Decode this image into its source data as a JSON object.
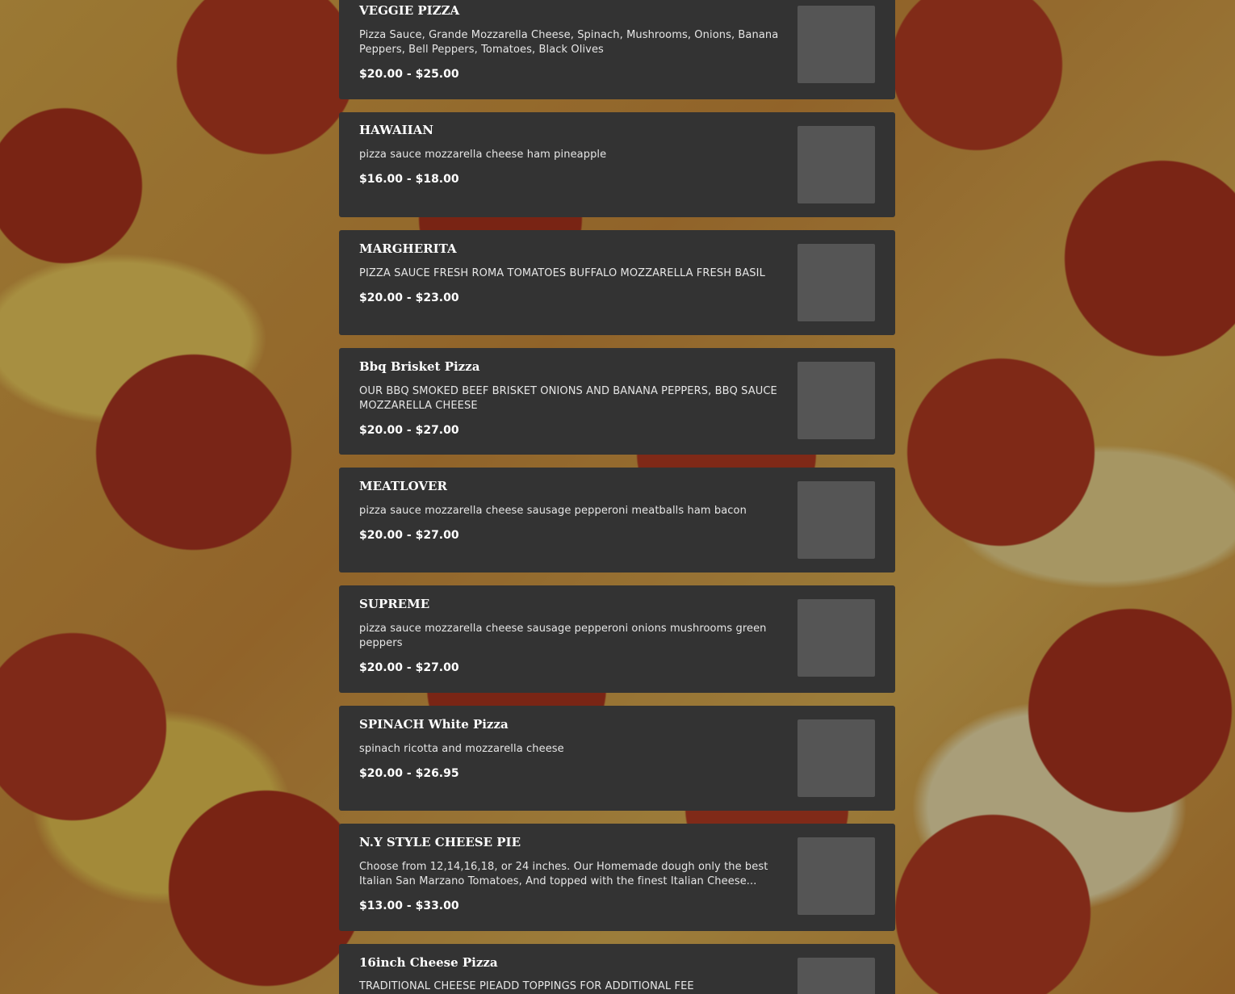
{
  "menu": {
    "items": [
      {
        "name": "VEGGIE PIZZA",
        "description": "Pizza Sauce, Grande Mozzarella Cheese, Spinach, Mushrooms, Onions, Banana Peppers, Bell Peppers, Tomatoes, Black Olives",
        "price": "$20.00 - $25.00"
      },
      {
        "name": "HAWAIIAN",
        "description": "pizza sauce mozzarella cheese ham pineapple",
        "price": "$16.00 - $18.00"
      },
      {
        "name": "MARGHERITA",
        "description": "PIZZA SAUCE FRESH ROMA TOMATOES BUFFALO MOZZARELLA FRESH BASIL",
        "price": "$20.00 - $23.00"
      },
      {
        "name": "Bbq Brisket Pizza",
        "description": "OUR BBQ SMOKED BEEF BRISKET ONIONS AND BANANA PEPPERS, BBQ SAUCE MOZZARELLA CHEESE",
        "price": "$20.00 - $27.00"
      },
      {
        "name": "MEATLOVER",
        "description": "pizza sauce mozzarella cheese sausage pepperoni meatballs ham bacon",
        "price": "$20.00 - $27.00"
      },
      {
        "name": "SUPREME",
        "description": "pizza sauce mozzarella cheese sausage pepperoni onions mushrooms green peppers",
        "price": "$20.00 - $27.00"
      },
      {
        "name": "SPINACH White Pizza",
        "description": "spinach ricotta and mozzarella cheese",
        "price": "$20.00 - $26.95"
      },
      {
        "name": "N.Y STYLE CHEESE PIE",
        "description": "Choose from 12,14,16,18, or 24 inches. Our Homemade dough only the best Italian San Marzano Tomatoes, And topped with the finest Italian Cheese...",
        "price": "$13.00 - $33.00"
      },
      {
        "name": "16inch Cheese Pizza",
        "description": "TRADITIONAL CHEESE PIEADD TOPPINGS FOR ADDITIONAL FEE",
        "price": ""
      }
    ]
  }
}
